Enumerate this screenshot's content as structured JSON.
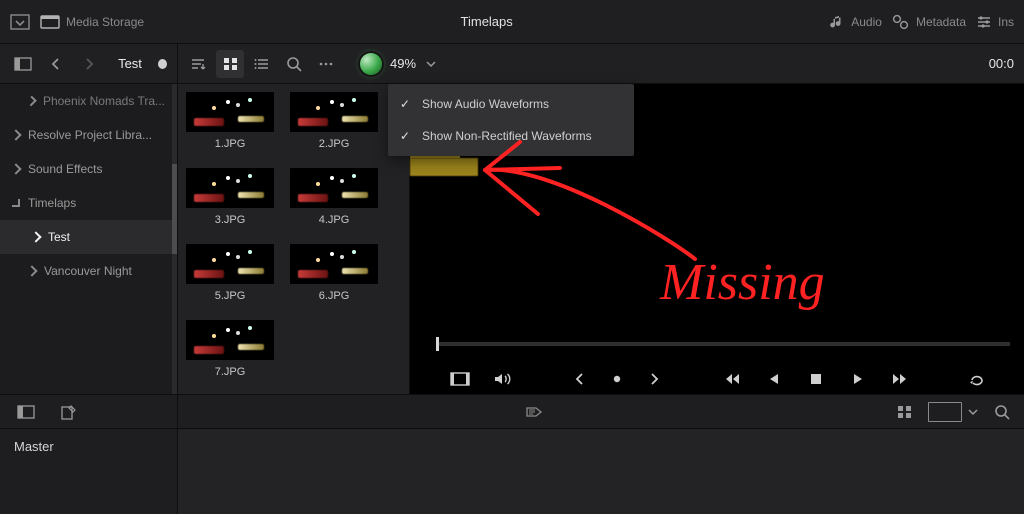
{
  "header": {
    "media_label": "Media Storage",
    "title": "Timelaps",
    "audio_label": "Audio",
    "metadata_label": "Metadata",
    "inspector_label": "Ins"
  },
  "toolbar": {
    "bin_label": "Test",
    "zoom_percent": "49%",
    "timecode": "00:0"
  },
  "tree": {
    "items": [
      {
        "label": "Phoenix Nomads Tra...",
        "level": 1,
        "expanded": false,
        "cut": true
      },
      {
        "label": "Resolve Project Libra...",
        "level": 0,
        "expanded": false
      },
      {
        "label": "Sound Effects",
        "level": 0,
        "expanded": false
      },
      {
        "label": "Timelaps",
        "level": 0,
        "expanded": true
      },
      {
        "label": "Test",
        "level": 1,
        "selected": true
      },
      {
        "label": "Vancouver Night",
        "level": 1,
        "expanded": false
      }
    ]
  },
  "browser": {
    "clips": [
      {
        "name": "1.JPG"
      },
      {
        "name": "2.JPG"
      },
      {
        "name": "3.JPG"
      },
      {
        "name": "4.JPG"
      },
      {
        "name": "5.JPG"
      },
      {
        "name": "6.JPG"
      },
      {
        "name": "7.JPG"
      }
    ]
  },
  "menu": {
    "items": [
      {
        "label": "Show Audio Waveforms",
        "checked": true
      },
      {
        "label": "Show Non-Rectified Waveforms",
        "checked": true
      }
    ]
  },
  "annotation": {
    "text": "Missing"
  },
  "bottom": {
    "master_label": "Master"
  }
}
